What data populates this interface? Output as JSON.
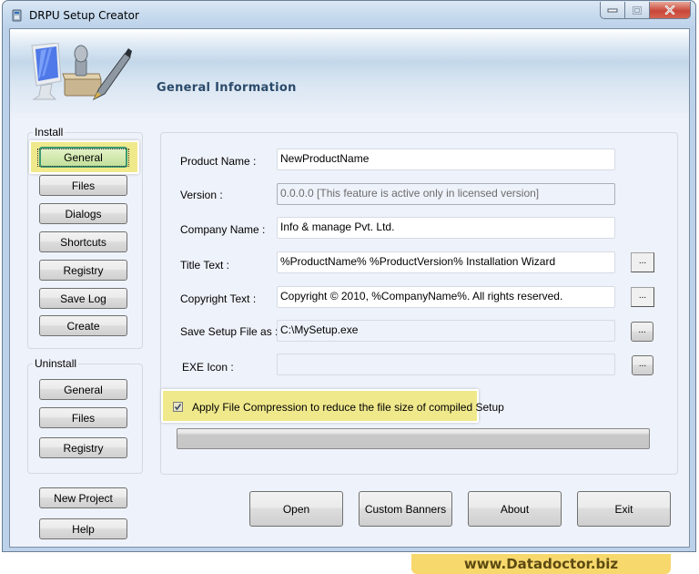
{
  "window": {
    "title": "DRPU Setup Creator",
    "icons": {
      "app": "setup-app-icon",
      "minimize": "minimize-icon",
      "maximize": "maximize-icon",
      "close": "close-icon"
    }
  },
  "banner": {
    "title": "General Information",
    "art": "computer-stamp-pen-icon"
  },
  "sidebar": {
    "install_label": "Install",
    "install_items": [
      {
        "label": "General",
        "active": true
      },
      {
        "label": "Files"
      },
      {
        "label": "Dialogs"
      },
      {
        "label": "Shortcuts"
      },
      {
        "label": "Registry"
      },
      {
        "label": "Save Log"
      },
      {
        "label": "Create"
      }
    ],
    "uninstall_label": "Uninstall",
    "uninstall_items": [
      {
        "label": "General"
      },
      {
        "label": "Files"
      },
      {
        "label": "Registry"
      }
    ],
    "new_project": "New Project",
    "help": "Help"
  },
  "form": {
    "product_name": {
      "label": "Product Name :",
      "value": "NewProductName"
    },
    "version": {
      "label": "Version :",
      "value": "0.0.0.0 [This feature is active only in licensed version]"
    },
    "company_name": {
      "label": "Company Name :",
      "value": "Info & manage Pvt. Ltd."
    },
    "title_text": {
      "label": "Title Text :",
      "value": "%ProductName% %ProductVersion% Installation Wizard"
    },
    "copyright_text": {
      "label": "Copyright Text :",
      "value": "Copyright © 2010, %CompanyName%. All rights reserved."
    },
    "save_setup_file": {
      "label": "Save Setup File as :",
      "value": "C:\\MySetup.exe"
    },
    "exe_icon": {
      "label": "EXE Icon :",
      "value": ""
    },
    "browse_label": "...",
    "compression": {
      "label": "Apply File Compression to reduce the file size of compiled Setup",
      "checked": true
    },
    "progress": {
      "percent": 0
    }
  },
  "footer": {
    "open": "Open",
    "custom_banners": "Custom Banners",
    "about": "About",
    "exit": "Exit"
  },
  "watermark": "www.Datadoctor.biz",
  "colors": {
    "highlight": "#f0e98c",
    "active_button": "#c4e09a",
    "banner_title": "#2b4a6a",
    "watermark_bg": "#f7d86c",
    "close_button": "#c9473a"
  }
}
